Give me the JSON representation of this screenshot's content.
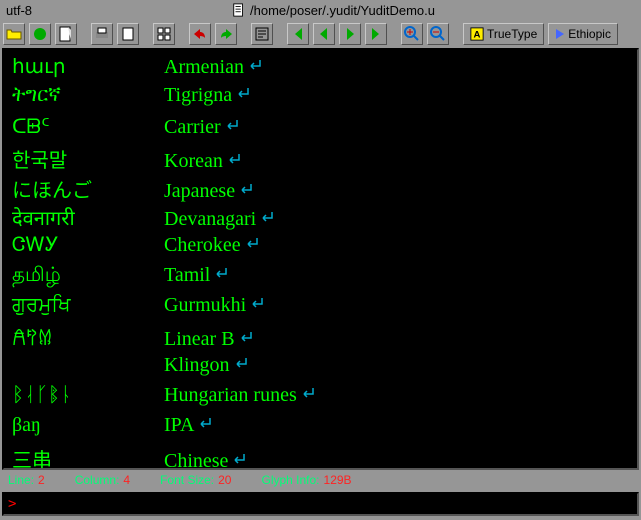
{
  "titlebar": {
    "encoding": "utf-8",
    "filepath": "/home/poser/.yudit/YuditDemo.u"
  },
  "toolbar": {
    "font_mode": "TrueType",
    "script_mode": "Ethiopic"
  },
  "rows": [
    {
      "native": "հաւր",
      "name": "Armenian"
    },
    {
      "native": "ትግርኛ",
      "name": "Tigrigna"
    },
    {
      "native": "ᑕᗸᑦ",
      "name": "Carrier"
    },
    {
      "native": "한국말",
      "name": "Korean"
    },
    {
      "native": "にほんご",
      "name": "Japanese"
    },
    {
      "native": "देवनागरी",
      "name": "Devanagari"
    },
    {
      "native": "ᏣᎳᎩ",
      "name": "Cherokee"
    },
    {
      "native": "தமிழ்",
      "name": "Tamil"
    },
    {
      "native": "ਗੁਰਮੁਖਿ",
      "name": "Gurmukhi"
    },
    {
      "native": "𐀁𐀰𐀔",
      "name": "Linear B"
    },
    {
      "native": "",
      "name": "Klingon"
    },
    {
      "native": "ᛒᛆᚴᛔᚿ",
      "name": "Hungarian runes"
    },
    {
      "native": "βaŋ",
      "name": "IPA"
    },
    {
      "native": "三串",
      "name": "Chinese"
    }
  ],
  "status": {
    "line_label": "Line:",
    "line_value": "2",
    "column_label": "Column:",
    "column_value": "4",
    "fontsize_label": "Font Size:",
    "fontsize_value": "20",
    "glyph_label": "Glyph Info:",
    "glyph_value": "129B"
  },
  "command": {
    "prompt": ">"
  }
}
